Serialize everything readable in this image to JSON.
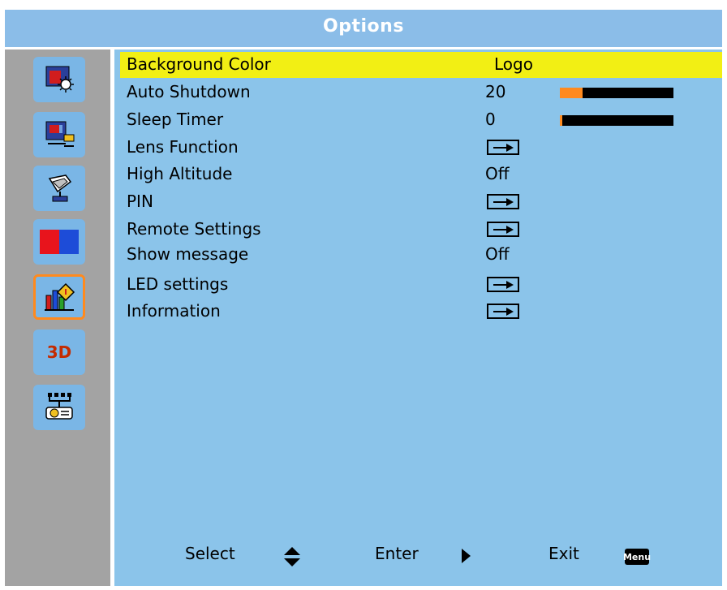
{
  "window": {
    "title": "Options"
  },
  "sidebar": {
    "tabs": [
      {
        "name": "image-settings-icon",
        "label": ""
      },
      {
        "name": "display-settings-icon",
        "label": ""
      },
      {
        "name": "setup-icon",
        "label": ""
      },
      {
        "name": "color-icon",
        "label": ""
      },
      {
        "name": "options-icon",
        "label": "",
        "active": true
      },
      {
        "name": "3d-icon",
        "label": "3D"
      },
      {
        "name": "network-icon",
        "label": ""
      }
    ]
  },
  "menu": {
    "rows": [
      {
        "label": "Background Color",
        "value": "Logo"
      },
      {
        "label": "Auto Shutdown",
        "value": "20",
        "level": 0.2
      },
      {
        "label": "Sleep Timer",
        "value": "0",
        "level": 0.0
      },
      {
        "label": "Lens Function",
        "value": ""
      },
      {
        "label": "High Altitude",
        "value": "Off"
      },
      {
        "label": "PIN",
        "value": ""
      },
      {
        "label": "Remote Settings",
        "value": ""
      },
      {
        "label": "Show message",
        "value": "Off"
      },
      {
        "label": "LED settings",
        "value": ""
      },
      {
        "label": "Information",
        "value": ""
      }
    ]
  },
  "footer": {
    "select_label": "Select",
    "enter_label": "Enter",
    "exit_label": "Exit",
    "menu_badge": "Menu"
  },
  "colors": {
    "highlight": "#f2ef14",
    "accent": "#ff8a1e",
    "panel": "#8bc4ea",
    "sidebar": "#a3a3a3"
  }
}
